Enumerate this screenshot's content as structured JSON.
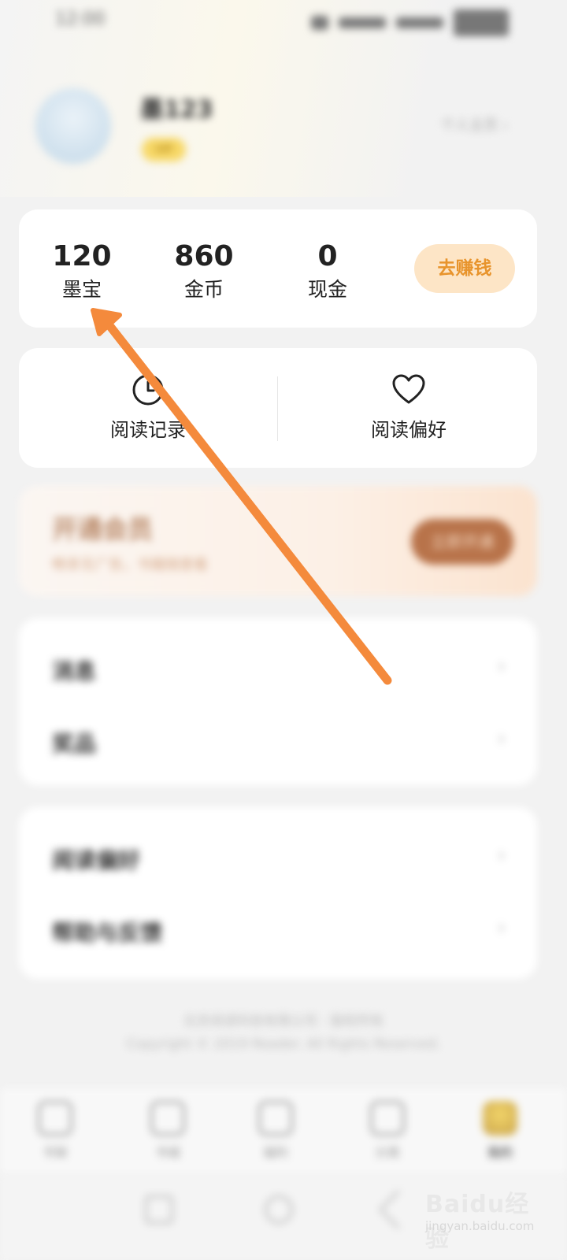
{
  "status_bar": {
    "time": "12:00"
  },
  "profile": {
    "name": "墨123",
    "badge": "VIP",
    "link_label": "个人主页 ›"
  },
  "assets": {
    "items": [
      {
        "value": "120",
        "label": "墨宝"
      },
      {
        "value": "860",
        "label": "金币"
      },
      {
        "value": "0",
        "label": "现金"
      }
    ],
    "earn_button": "去赚钱"
  },
  "shortcuts": [
    {
      "label": "阅读记录",
      "icon": "clock-icon"
    },
    {
      "label": "阅读偏好",
      "icon": "heart-icon"
    }
  ],
  "membership": {
    "title": "开通会员",
    "subtitle": "畅享无广告，书籍随意看",
    "button": "立即开通"
  },
  "menu_group_1": [
    {
      "label": "消息"
    },
    {
      "label": "奖品"
    }
  ],
  "menu_group_2": [
    {
      "label": "阅读偏好"
    },
    {
      "label": "帮助与反馈"
    }
  ],
  "footer": {
    "line1": "北京阅读科技有限公司 · 版权所有",
    "line2": "Copyright © 2019 Reader. All Rights Reserved."
  },
  "tab_bar": [
    {
      "label": "书架"
    },
    {
      "label": "书城"
    },
    {
      "label": "福利"
    },
    {
      "label": "分类"
    },
    {
      "label": "我的"
    }
  ],
  "watermark": {
    "logo": "Baidu经验",
    "site": "jingyan.baidu.com"
  },
  "colors": {
    "accent": "#e8942c",
    "earn_button_bg": "#fde5c6",
    "annotation_arrow": "#f48a3c",
    "member_button": "#b8734a"
  }
}
